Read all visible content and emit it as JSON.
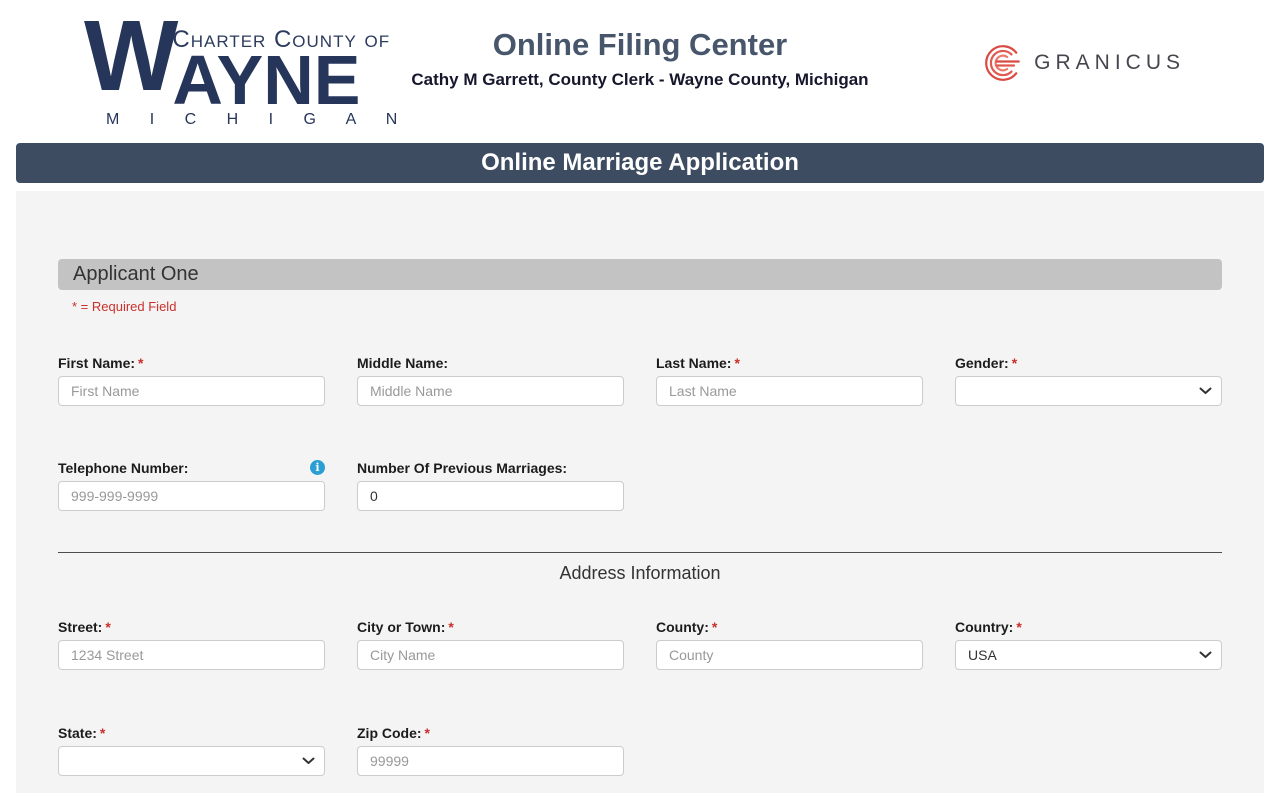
{
  "header": {
    "logo": {
      "w": "W",
      "ayne": "AYNE",
      "charter": "Charter County of",
      "michigan": "M I C H I G A N"
    },
    "title": "Online Filing Center",
    "subtitle": "Cathy M Garrett, County Clerk - Wayne County, Michigan",
    "granicus_wordmark": "GRANICUS"
  },
  "banner": {
    "title": "Online Marriage Application"
  },
  "form": {
    "section_title": "Applicant One",
    "required_note": "* = Required Field",
    "address_section_title": "Address Information",
    "fields": {
      "first_name": {
        "label": "First Name:",
        "required": "*",
        "placeholder": "First Name"
      },
      "middle_name": {
        "label": "Middle Name:",
        "placeholder": "Middle Name"
      },
      "last_name": {
        "label": "Last Name:",
        "required": "*",
        "placeholder": "Last Name"
      },
      "gender": {
        "label": "Gender:",
        "required": "*",
        "value": ""
      },
      "telephone": {
        "label": "Telephone Number:",
        "placeholder": "999-999-9999"
      },
      "previous_marriages": {
        "label": "Number Of Previous Marriages:",
        "value": "0"
      },
      "street": {
        "label": "Street:",
        "required": "*",
        "placeholder": "1234 Street"
      },
      "city": {
        "label": "City or Town:",
        "required": "*",
        "placeholder": "City Name"
      },
      "county": {
        "label": "County:",
        "required": "*",
        "placeholder": "County"
      },
      "country": {
        "label": "Country:",
        "required": "*",
        "value": "USA"
      },
      "state": {
        "label": "State:",
        "required": "*",
        "value": ""
      },
      "zip": {
        "label": "Zip Code:",
        "required": "*",
        "placeholder": "99999"
      }
    }
  },
  "icons": {
    "telephone_info": "info-icon",
    "select_chevron": "chevron-down-icon",
    "granicus_mark": "granicus-g-icon"
  },
  "colors": {
    "banner_bg": "#3e4c62",
    "panel_bg": "#f4f4f4",
    "section_bar_bg": "#c3c3c3",
    "required_red": "#c9302c",
    "wayne_navy": "#26355a",
    "title_slate": "#47566b",
    "granicus_red": "#d94a43",
    "info_blue": "#2b9ed3"
  }
}
